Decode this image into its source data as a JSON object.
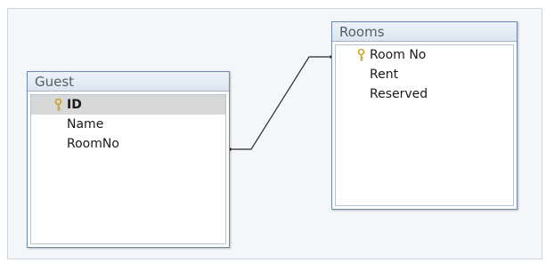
{
  "tables": [
    {
      "title": "Guest",
      "fields": [
        {
          "label": "ID",
          "primary_key": true,
          "selected": true
        },
        {
          "label": "Name",
          "primary_key": false,
          "selected": false
        },
        {
          "label": "RoomNo",
          "primary_key": false,
          "selected": false
        }
      ]
    },
    {
      "title": "Rooms",
      "fields": [
        {
          "label": "Room No",
          "primary_key": true,
          "selected": false
        },
        {
          "label": "Rent",
          "primary_key": false,
          "selected": false
        },
        {
          "label": "Reserved",
          "primary_key": false,
          "selected": false
        }
      ]
    }
  ],
  "relationship": {
    "from": "Guest.RoomNo",
    "to": "Rooms.Room No"
  },
  "colors": {
    "key_icon": "#c9a227",
    "line": "#2b2b2b",
    "header_border": "#6f8aab"
  }
}
